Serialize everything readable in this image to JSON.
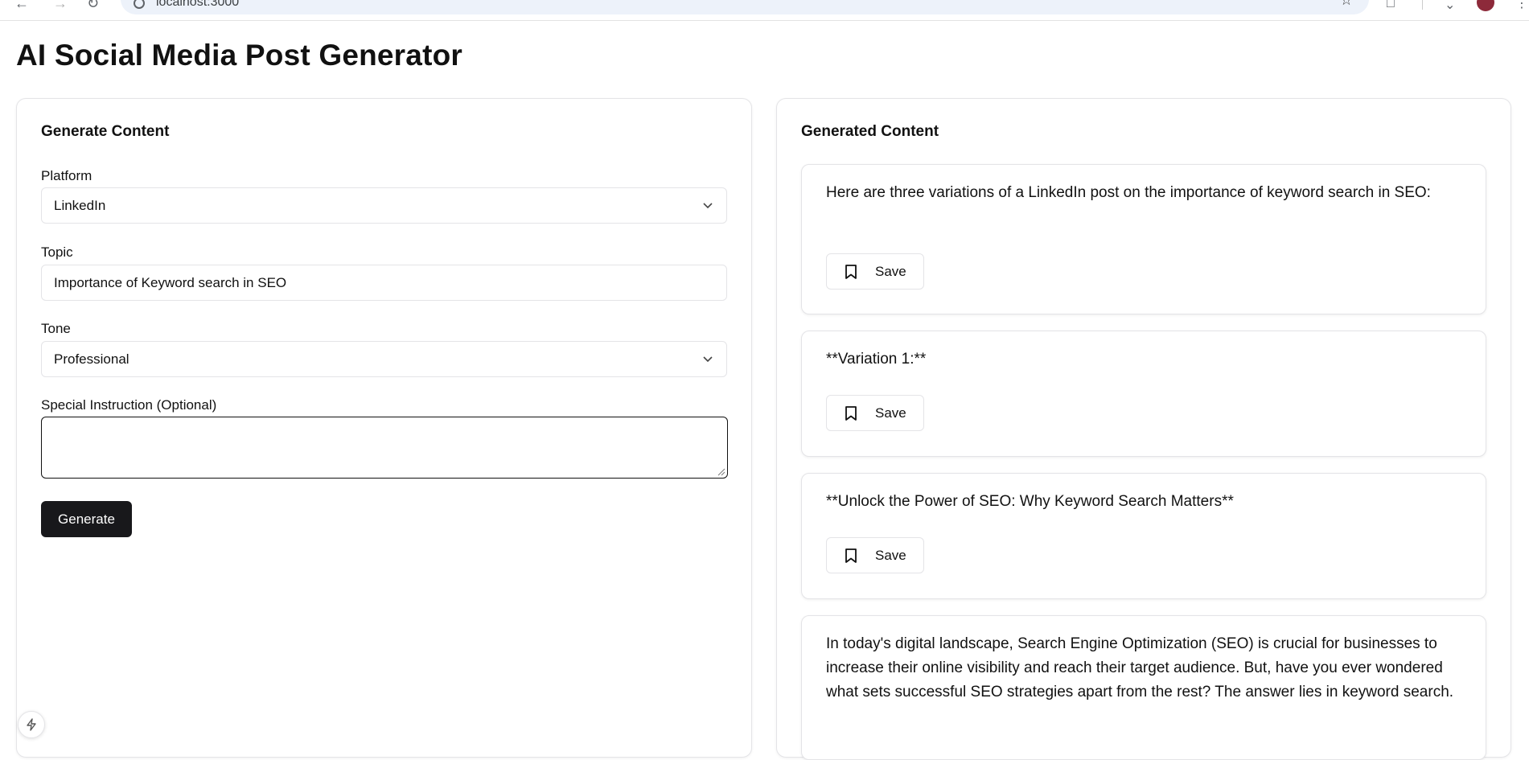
{
  "browser": {
    "url": "localhost:3000"
  },
  "page": {
    "title": "AI Social Media Post Generator"
  },
  "form": {
    "title": "Generate Content",
    "platform": {
      "label": "Platform",
      "value": "LinkedIn"
    },
    "topic": {
      "label": "Topic",
      "value": "Importance of Keyword search in SEO"
    },
    "tone": {
      "label": "Tone",
      "value": "Professional"
    },
    "instruction": {
      "label": "Special Instruction (Optional)",
      "value": ""
    },
    "generate_label": "Generate"
  },
  "results": {
    "title": "Generated Content",
    "save_label": "Save",
    "posts": [
      {
        "text": "Here are three variations of a LinkedIn post on the importance of keyword search in SEO:"
      },
      {
        "text": "**Variation 1:**"
      },
      {
        "text": "**Unlock the Power of SEO: Why Keyword Search Matters**"
      },
      {
        "text": "In today's digital landscape, Search Engine Optimization (SEO) is crucial for businesses to increase their online visibility and reach their target audience. But, have you ever wondered what sets successful SEO strategies apart from the rest? The answer lies in keyword search."
      }
    ]
  },
  "colors": {
    "primary_button": "#18181b",
    "border": "#e4e4e7",
    "text": "#111111"
  },
  "icons": {
    "select_chevron": "chevron-down-icon",
    "save": "bookmark-icon",
    "dev_indicator": "lightning-icon"
  }
}
